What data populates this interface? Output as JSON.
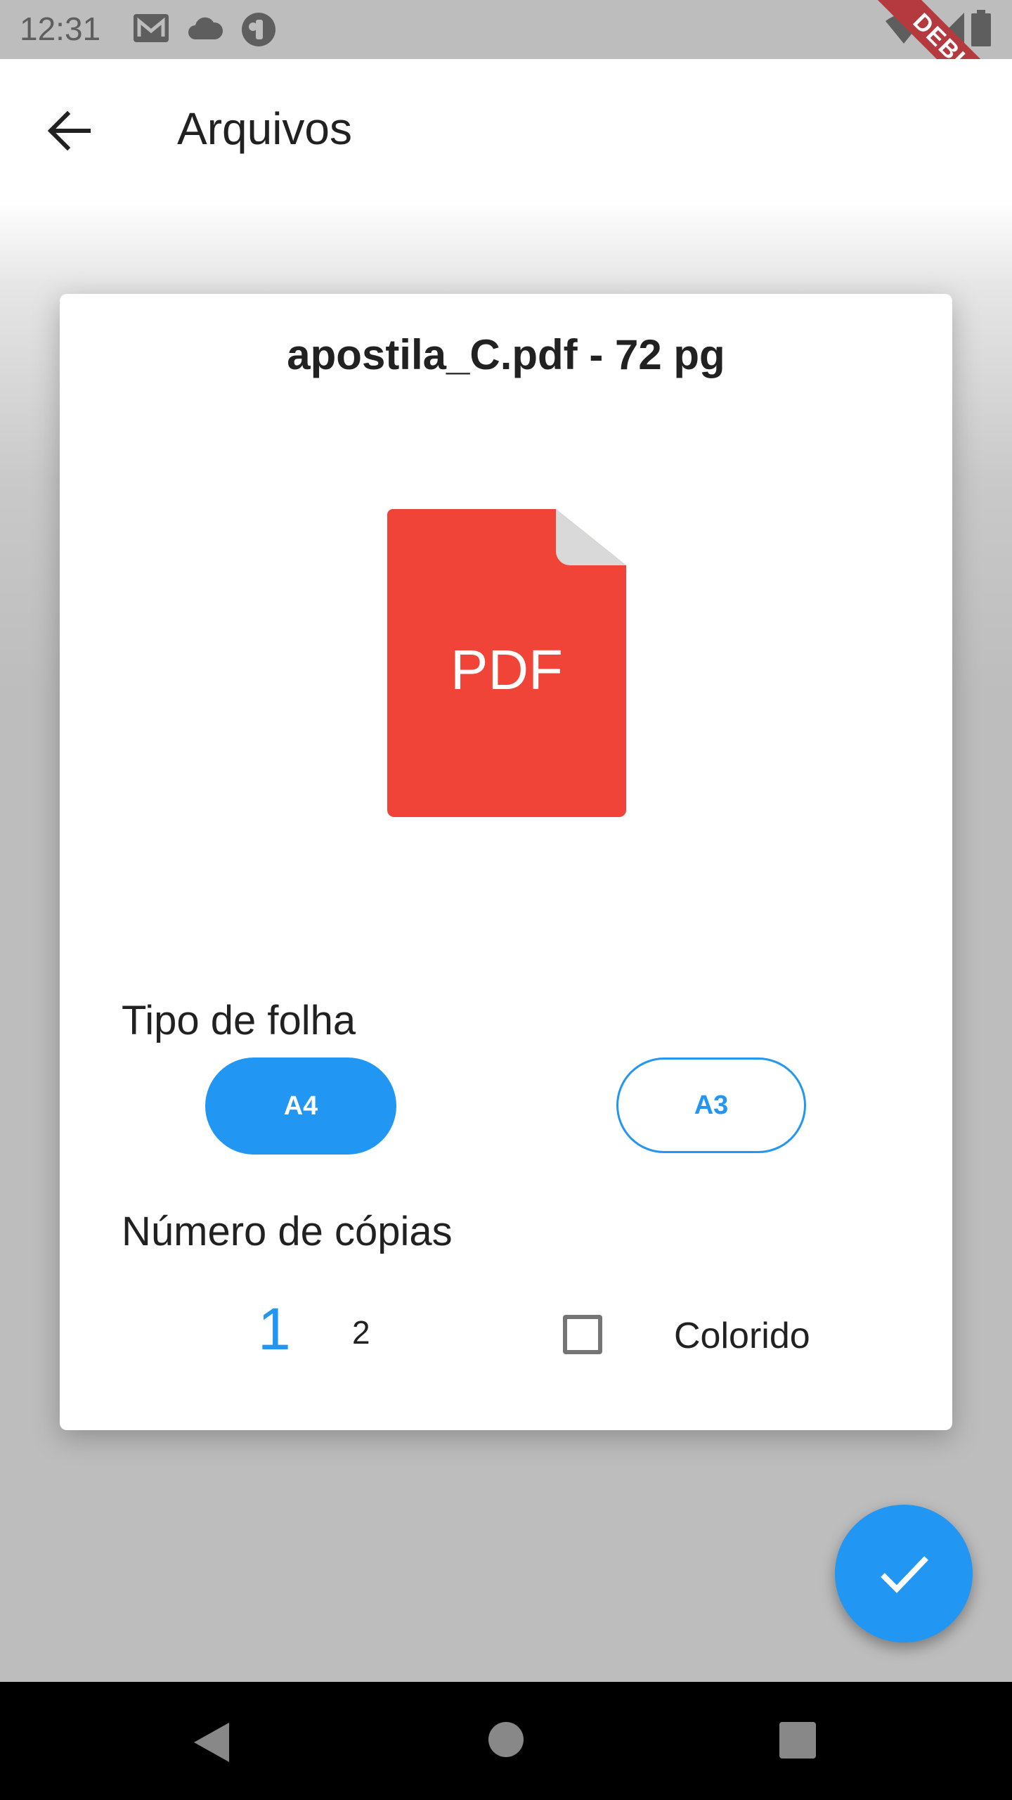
{
  "status_bar": {
    "time": "12:31",
    "icons": [
      "gmail-icon",
      "cloud-icon",
      "app-notification-icon",
      "wifi-icon",
      "signal-icon",
      "battery-icon"
    ],
    "debug_label": "DEBUG"
  },
  "app_bar": {
    "title": "Arquivos",
    "back_icon": "arrow-back-icon"
  },
  "card": {
    "file_title": "apostila_C.pdf - 72 pg",
    "file_icon_label": "PDF",
    "sheet_type_label": "Tipo de folha",
    "sheet_options": [
      {
        "label": "A4",
        "selected": true
      },
      {
        "label": "A3",
        "selected": false
      }
    ],
    "copies_label": "Número de cópias",
    "copies_selected": "1",
    "copies_next": "2",
    "color_label": "Colorido",
    "color_checked": false
  },
  "fab": {
    "icon": "check-icon"
  },
  "colors": {
    "accent": "#2196f3",
    "pdf_red": "#f04438",
    "status_bar": "#bdbdbd",
    "nav_bar": "#000000"
  }
}
